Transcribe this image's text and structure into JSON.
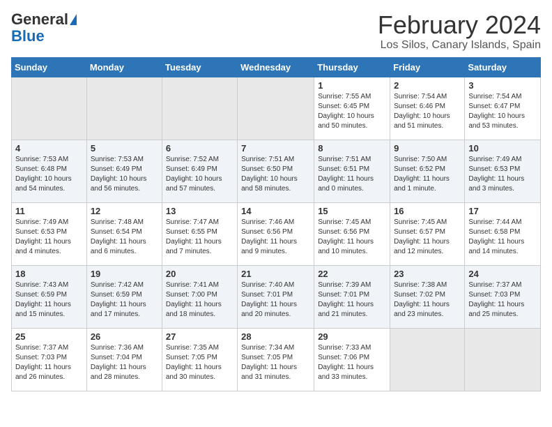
{
  "logo": {
    "line1": "General",
    "line2": "Blue"
  },
  "header": {
    "title": "February 2024",
    "subtitle": "Los Silos, Canary Islands, Spain"
  },
  "days_of_week": [
    "Sunday",
    "Monday",
    "Tuesday",
    "Wednesday",
    "Thursday",
    "Friday",
    "Saturday"
  ],
  "weeks": [
    [
      {
        "day": "",
        "info": ""
      },
      {
        "day": "",
        "info": ""
      },
      {
        "day": "",
        "info": ""
      },
      {
        "day": "",
        "info": ""
      },
      {
        "day": "1",
        "info": "Sunrise: 7:55 AM\nSunset: 6:45 PM\nDaylight: 10 hours\nand 50 minutes."
      },
      {
        "day": "2",
        "info": "Sunrise: 7:54 AM\nSunset: 6:46 PM\nDaylight: 10 hours\nand 51 minutes."
      },
      {
        "day": "3",
        "info": "Sunrise: 7:54 AM\nSunset: 6:47 PM\nDaylight: 10 hours\nand 53 minutes."
      }
    ],
    [
      {
        "day": "4",
        "info": "Sunrise: 7:53 AM\nSunset: 6:48 PM\nDaylight: 10 hours\nand 54 minutes."
      },
      {
        "day": "5",
        "info": "Sunrise: 7:53 AM\nSunset: 6:49 PM\nDaylight: 10 hours\nand 56 minutes."
      },
      {
        "day": "6",
        "info": "Sunrise: 7:52 AM\nSunset: 6:49 PM\nDaylight: 10 hours\nand 57 minutes."
      },
      {
        "day": "7",
        "info": "Sunrise: 7:51 AM\nSunset: 6:50 PM\nDaylight: 10 hours\nand 58 minutes."
      },
      {
        "day": "8",
        "info": "Sunrise: 7:51 AM\nSunset: 6:51 PM\nDaylight: 11 hours\nand 0 minutes."
      },
      {
        "day": "9",
        "info": "Sunrise: 7:50 AM\nSunset: 6:52 PM\nDaylight: 11 hours\nand 1 minute."
      },
      {
        "day": "10",
        "info": "Sunrise: 7:49 AM\nSunset: 6:53 PM\nDaylight: 11 hours\nand 3 minutes."
      }
    ],
    [
      {
        "day": "11",
        "info": "Sunrise: 7:49 AM\nSunset: 6:53 PM\nDaylight: 11 hours\nand 4 minutes."
      },
      {
        "day": "12",
        "info": "Sunrise: 7:48 AM\nSunset: 6:54 PM\nDaylight: 11 hours\nand 6 minutes."
      },
      {
        "day": "13",
        "info": "Sunrise: 7:47 AM\nSunset: 6:55 PM\nDaylight: 11 hours\nand 7 minutes."
      },
      {
        "day": "14",
        "info": "Sunrise: 7:46 AM\nSunset: 6:56 PM\nDaylight: 11 hours\nand 9 minutes."
      },
      {
        "day": "15",
        "info": "Sunrise: 7:45 AM\nSunset: 6:56 PM\nDaylight: 11 hours\nand 10 minutes."
      },
      {
        "day": "16",
        "info": "Sunrise: 7:45 AM\nSunset: 6:57 PM\nDaylight: 11 hours\nand 12 minutes."
      },
      {
        "day": "17",
        "info": "Sunrise: 7:44 AM\nSunset: 6:58 PM\nDaylight: 11 hours\nand 14 minutes."
      }
    ],
    [
      {
        "day": "18",
        "info": "Sunrise: 7:43 AM\nSunset: 6:59 PM\nDaylight: 11 hours\nand 15 minutes."
      },
      {
        "day": "19",
        "info": "Sunrise: 7:42 AM\nSunset: 6:59 PM\nDaylight: 11 hours\nand 17 minutes."
      },
      {
        "day": "20",
        "info": "Sunrise: 7:41 AM\nSunset: 7:00 PM\nDaylight: 11 hours\nand 18 minutes."
      },
      {
        "day": "21",
        "info": "Sunrise: 7:40 AM\nSunset: 7:01 PM\nDaylight: 11 hours\nand 20 minutes."
      },
      {
        "day": "22",
        "info": "Sunrise: 7:39 AM\nSunset: 7:01 PM\nDaylight: 11 hours\nand 21 minutes."
      },
      {
        "day": "23",
        "info": "Sunrise: 7:38 AM\nSunset: 7:02 PM\nDaylight: 11 hours\nand 23 minutes."
      },
      {
        "day": "24",
        "info": "Sunrise: 7:37 AM\nSunset: 7:03 PM\nDaylight: 11 hours\nand 25 minutes."
      }
    ],
    [
      {
        "day": "25",
        "info": "Sunrise: 7:37 AM\nSunset: 7:03 PM\nDaylight: 11 hours\nand 26 minutes."
      },
      {
        "day": "26",
        "info": "Sunrise: 7:36 AM\nSunset: 7:04 PM\nDaylight: 11 hours\nand 28 minutes."
      },
      {
        "day": "27",
        "info": "Sunrise: 7:35 AM\nSunset: 7:05 PM\nDaylight: 11 hours\nand 30 minutes."
      },
      {
        "day": "28",
        "info": "Sunrise: 7:34 AM\nSunset: 7:05 PM\nDaylight: 11 hours\nand 31 minutes."
      },
      {
        "day": "29",
        "info": "Sunrise: 7:33 AM\nSunset: 7:06 PM\nDaylight: 11 hours\nand 33 minutes."
      },
      {
        "day": "",
        "info": ""
      },
      {
        "day": "",
        "info": ""
      }
    ]
  ]
}
